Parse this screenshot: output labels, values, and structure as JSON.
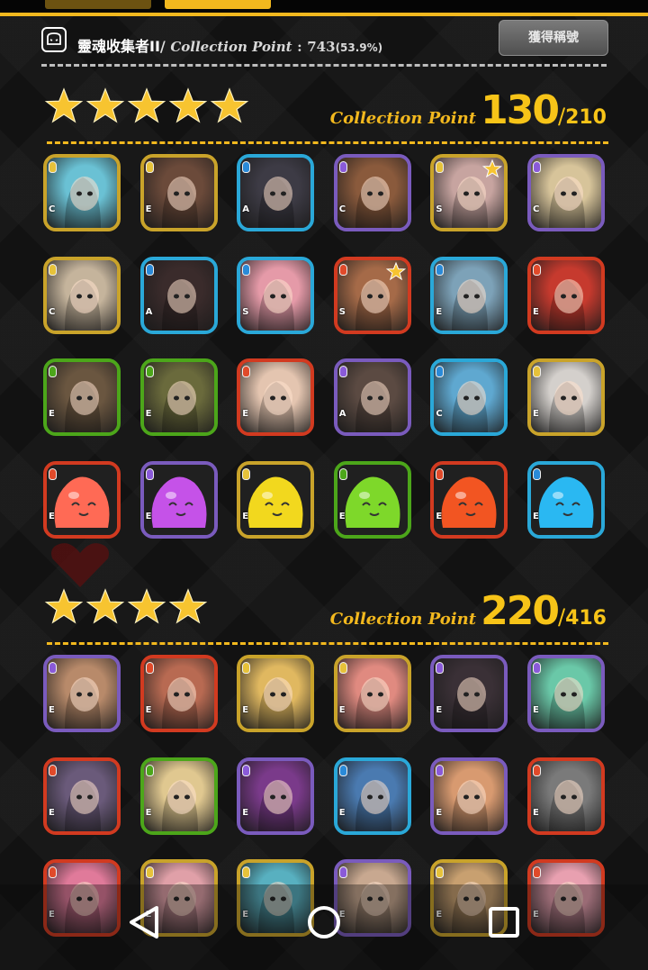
{
  "colors": {
    "accent": "#f2b81e",
    "border_gold": "#c9a32a",
    "border_blue": "#2aa8d8",
    "border_purple": "#7a5bbd",
    "border_red": "#d23a20",
    "border_green": "#4ca61a"
  },
  "header": {
    "icon": "ghost-icon",
    "title": "靈魂收集者II",
    "slash": "/",
    "cp_label": "Collection Point",
    "cp_colon": ":",
    "cp_value": "743",
    "cp_percent": "(53.9%)",
    "title_button_label": "獲得稱號"
  },
  "sections": [
    {
      "star_count": 5,
      "cp_label": "Collection Point",
      "cp_value": "130",
      "cp_slash": "/",
      "cp_total": "210"
    },
    {
      "star_count": 4,
      "cp_label": "Collection Point",
      "cp_value": "220",
      "cp_slash": "/",
      "cp_total": "416"
    }
  ],
  "section1_cards": [
    {
      "rank": "C",
      "attr": "light",
      "frame": "gold",
      "tone": "#6ac1d4"
    },
    {
      "rank": "E",
      "attr": "light",
      "frame": "gold",
      "tone": "#6b4a3a"
    },
    {
      "rank": "A",
      "attr": "water",
      "frame": "blue",
      "tone": "#3d3b45"
    },
    {
      "rank": "C",
      "attr": "dark",
      "frame": "purple",
      "tone": "#8a5a3c"
    },
    {
      "rank": "S",
      "attr": "light",
      "frame": "gold",
      "tone": "#c7a4a0",
      "star": true
    },
    {
      "rank": "C",
      "attr": "dark",
      "frame": "purple",
      "tone": "#d7c49a"
    },
    {
      "rank": "C",
      "attr": "light",
      "frame": "gold",
      "tone": "#c5b49c"
    },
    {
      "rank": "A",
      "attr": "water",
      "frame": "blue",
      "tone": "#3a2b2b"
    },
    {
      "rank": "S",
      "attr": "water",
      "frame": "blue",
      "tone": "#e59aa8"
    },
    {
      "rank": "S",
      "attr": "fire",
      "frame": "red",
      "tone": "#a56a48",
      "star": true
    },
    {
      "rank": "E",
      "attr": "water",
      "frame": "blue",
      "tone": "#7da2b8"
    },
    {
      "rank": "E",
      "attr": "fire",
      "frame": "red",
      "tone": "#c63a2e"
    },
    {
      "rank": "E",
      "attr": "earth",
      "frame": "green",
      "tone": "#6a5640"
    },
    {
      "rank": "E",
      "attr": "earth",
      "frame": "green",
      "tone": "#6a6a3c"
    },
    {
      "rank": "E",
      "attr": "fire",
      "frame": "red",
      "tone": "#e4c5b0"
    },
    {
      "rank": "A",
      "attr": "dark",
      "frame": "purple",
      "tone": "#5b4a42"
    },
    {
      "rank": "C",
      "attr": "water",
      "frame": "blue",
      "tone": "#5fa8d0"
    },
    {
      "rank": "E",
      "attr": "light",
      "frame": "gold",
      "tone": "#d4d0cc"
    },
    {
      "rank": "E",
      "attr": "fire",
      "frame": "red",
      "tone": "#ff6a55",
      "slime": true
    },
    {
      "rank": "E",
      "attr": "dark",
      "frame": "purple",
      "tone": "#c552e8",
      "slime": true
    },
    {
      "rank": "E",
      "attr": "light",
      "frame": "gold",
      "tone": "#f2d81e",
      "slime": true
    },
    {
      "rank": "E",
      "attr": "earth",
      "frame": "green",
      "tone": "#7ed82a",
      "slime": true
    },
    {
      "rank": "E",
      "attr": "fire",
      "frame": "red",
      "tone": "#f25522",
      "slime": true
    },
    {
      "rank": "E",
      "attr": "water",
      "frame": "blue",
      "tone": "#2ab8f2",
      "slime": true
    }
  ],
  "section2_cards": [
    {
      "rank": "E",
      "attr": "dark",
      "frame": "purple",
      "tone": "#b88a6a"
    },
    {
      "rank": "E",
      "attr": "fire",
      "frame": "red",
      "tone": "#b86a52"
    },
    {
      "rank": "E",
      "attr": "light",
      "frame": "gold",
      "tone": "#e0b860"
    },
    {
      "rank": "E",
      "attr": "light",
      "frame": "gold",
      "tone": "#e08a80"
    },
    {
      "rank": "E",
      "attr": "dark",
      "frame": "purple",
      "tone": "#3a3036"
    },
    {
      "rank": "E",
      "attr": "dark",
      "frame": "purple",
      "tone": "#6ac8a8"
    },
    {
      "rank": "E",
      "attr": "fire",
      "frame": "red",
      "tone": "#6a5a7a"
    },
    {
      "rank": "E",
      "attr": "earth",
      "frame": "green",
      "tone": "#e0c890"
    },
    {
      "rank": "E",
      "attr": "dark",
      "frame": "purple",
      "tone": "#7a3a8a"
    },
    {
      "rank": "E",
      "attr": "water",
      "frame": "blue",
      "tone": "#4a7ab0"
    },
    {
      "rank": "E",
      "attr": "dark",
      "frame": "purple",
      "tone": "#d89a70"
    },
    {
      "rank": "E",
      "attr": "fire",
      "frame": "red",
      "tone": "#7a7a7a"
    },
    {
      "rank": "E",
      "attr": "fire",
      "frame": "red",
      "tone": "#e07a9a"
    },
    {
      "rank": "E",
      "attr": "light",
      "frame": "gold",
      "tone": "#e0a0a8"
    },
    {
      "rank": "E",
      "attr": "light",
      "frame": "gold",
      "tone": "#58b0c0"
    },
    {
      "rank": "E",
      "attr": "dark",
      "frame": "purple",
      "tone": "#c8a890"
    },
    {
      "rank": "E",
      "attr": "light",
      "frame": "gold",
      "tone": "#c8a070"
    },
    {
      "rank": "E",
      "attr": "fire",
      "frame": "red",
      "tone": "#e8a0b0"
    }
  ],
  "navbar": {
    "back": "back-triangle-icon",
    "home": "home-circle-icon",
    "recents": "recents-square-icon"
  }
}
